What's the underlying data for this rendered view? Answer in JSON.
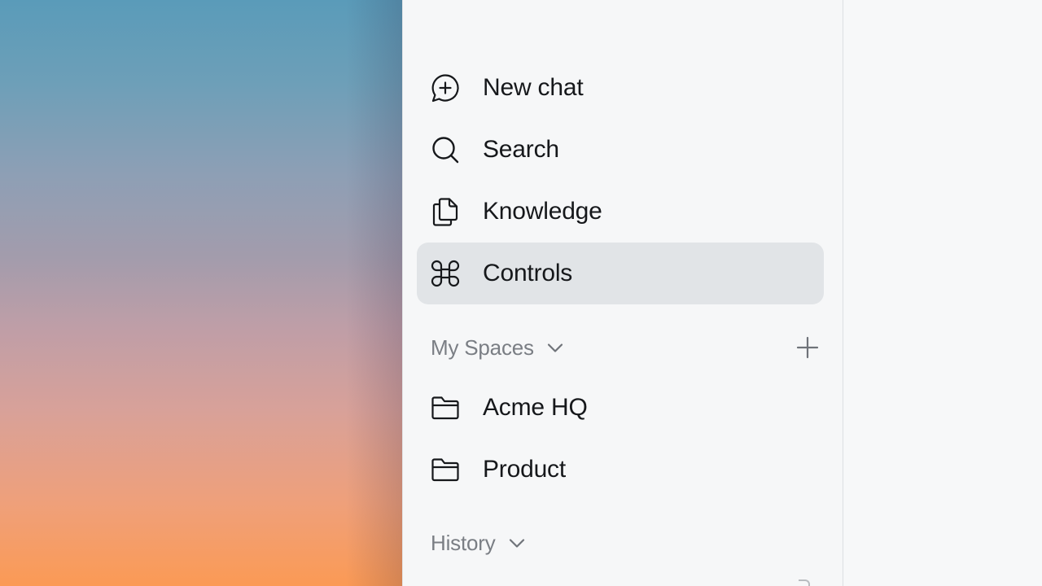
{
  "sidebar": {
    "nav": [
      {
        "id": "new-chat",
        "label": "New chat",
        "icon": "chat-plus-icon",
        "active": false
      },
      {
        "id": "search",
        "label": "Search",
        "icon": "search-icon",
        "active": false
      },
      {
        "id": "knowledge",
        "label": "Knowledge",
        "icon": "documents-icon",
        "active": false
      },
      {
        "id": "controls",
        "label": "Controls",
        "icon": "command-icon",
        "active": true
      }
    ],
    "spaces": {
      "title": "My Spaces",
      "add_icon": "plus-icon",
      "items": [
        {
          "label": "Acme HQ",
          "icon": "folder-icon"
        },
        {
          "label": "Product",
          "icon": "folder-icon"
        }
      ]
    },
    "history": {
      "title": "History"
    }
  },
  "colors": {
    "sidebar_bg": "#f6f7f8",
    "active_item_bg": "#e1e4e7",
    "text_primary": "#16181b",
    "text_secondary": "#7a7e84"
  }
}
